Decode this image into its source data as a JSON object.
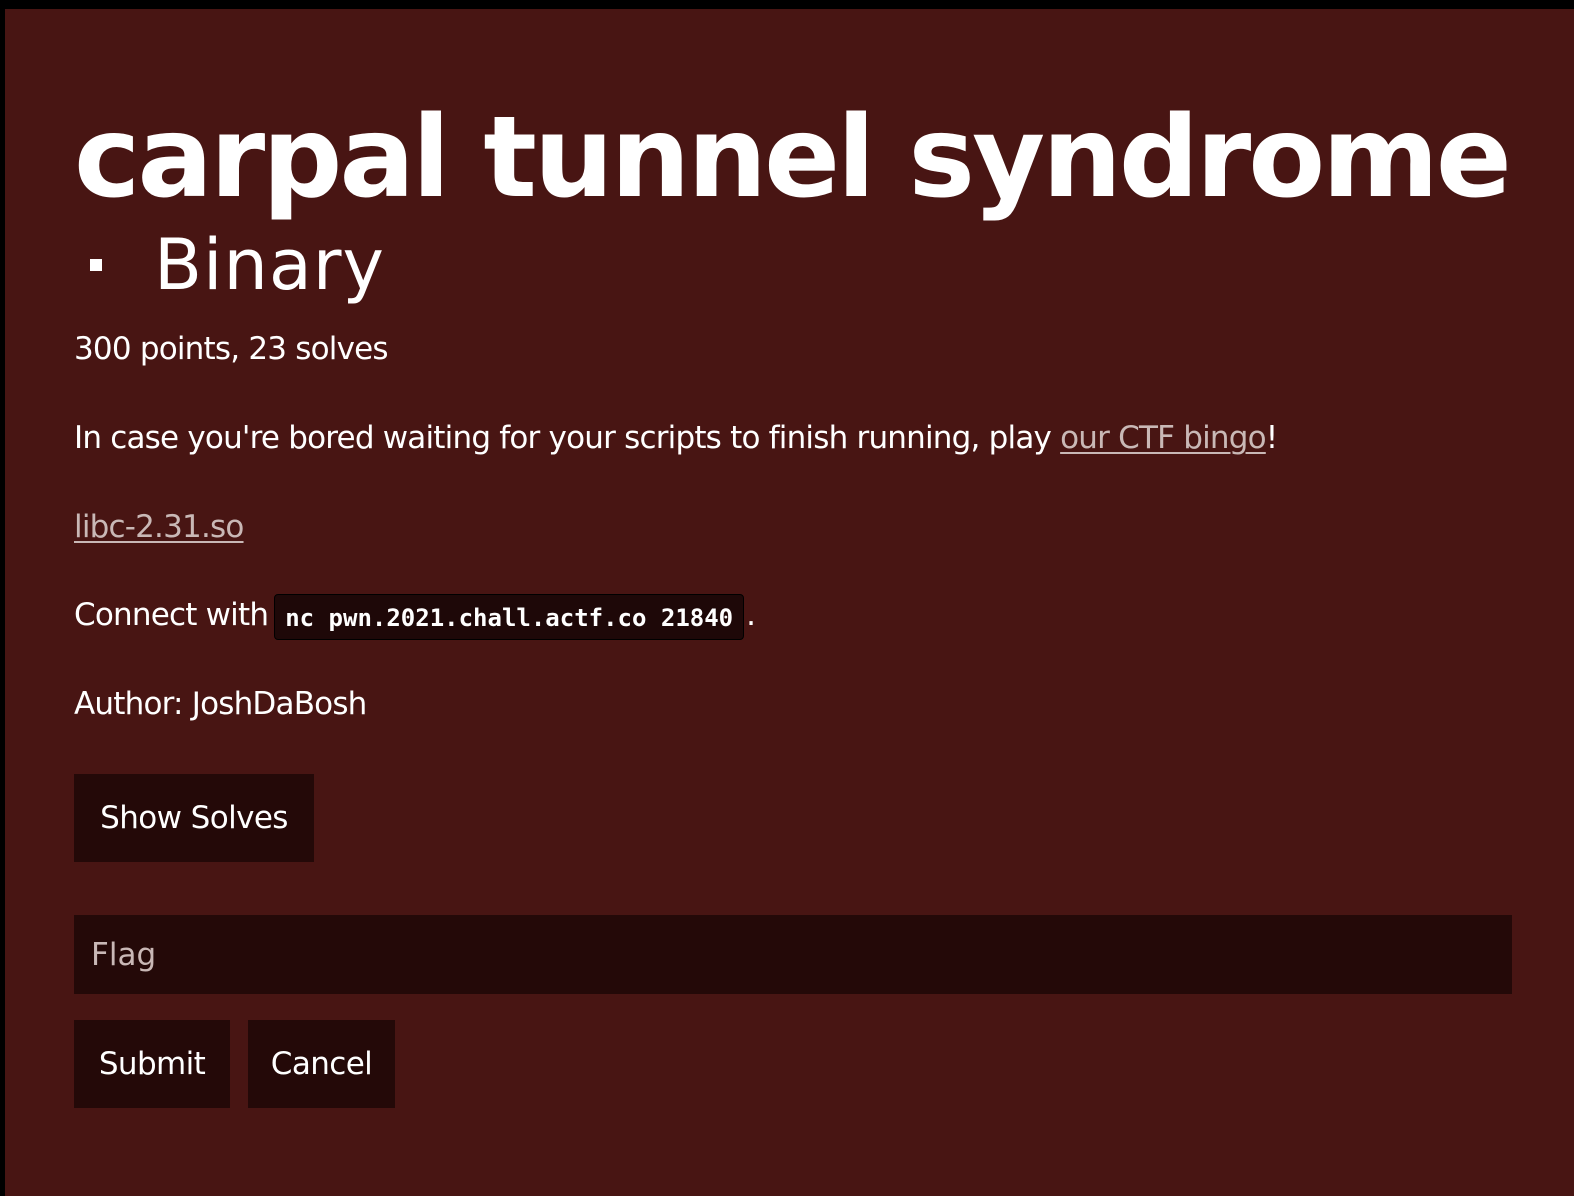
{
  "challenge": {
    "title": "carpal tunnel syndrome",
    "category": "Binary",
    "points_solves": "300 points, 23 solves",
    "description_prefix": "In case you're bored waiting for your scripts to finish running, play ",
    "description_link": "our CTF bingo",
    "description_suffix": "!",
    "file_link": "libc-2.31.so",
    "connect_prefix": "Connect with",
    "connect_command": "nc pwn.2021.chall.actf.co 21840",
    "connect_suffix": ".",
    "author": "Author: JoshDaBosh"
  },
  "actions": {
    "show_solves_label": "Show Solves",
    "flag_placeholder": "Flag",
    "submit_label": "Submit",
    "cancel_label": "Cancel"
  },
  "colors": {
    "page_background": "#000000",
    "panel_background": "#481513",
    "button_background": "#240908",
    "link_color": "#c9b8b6",
    "text_color": "#ffffff"
  }
}
